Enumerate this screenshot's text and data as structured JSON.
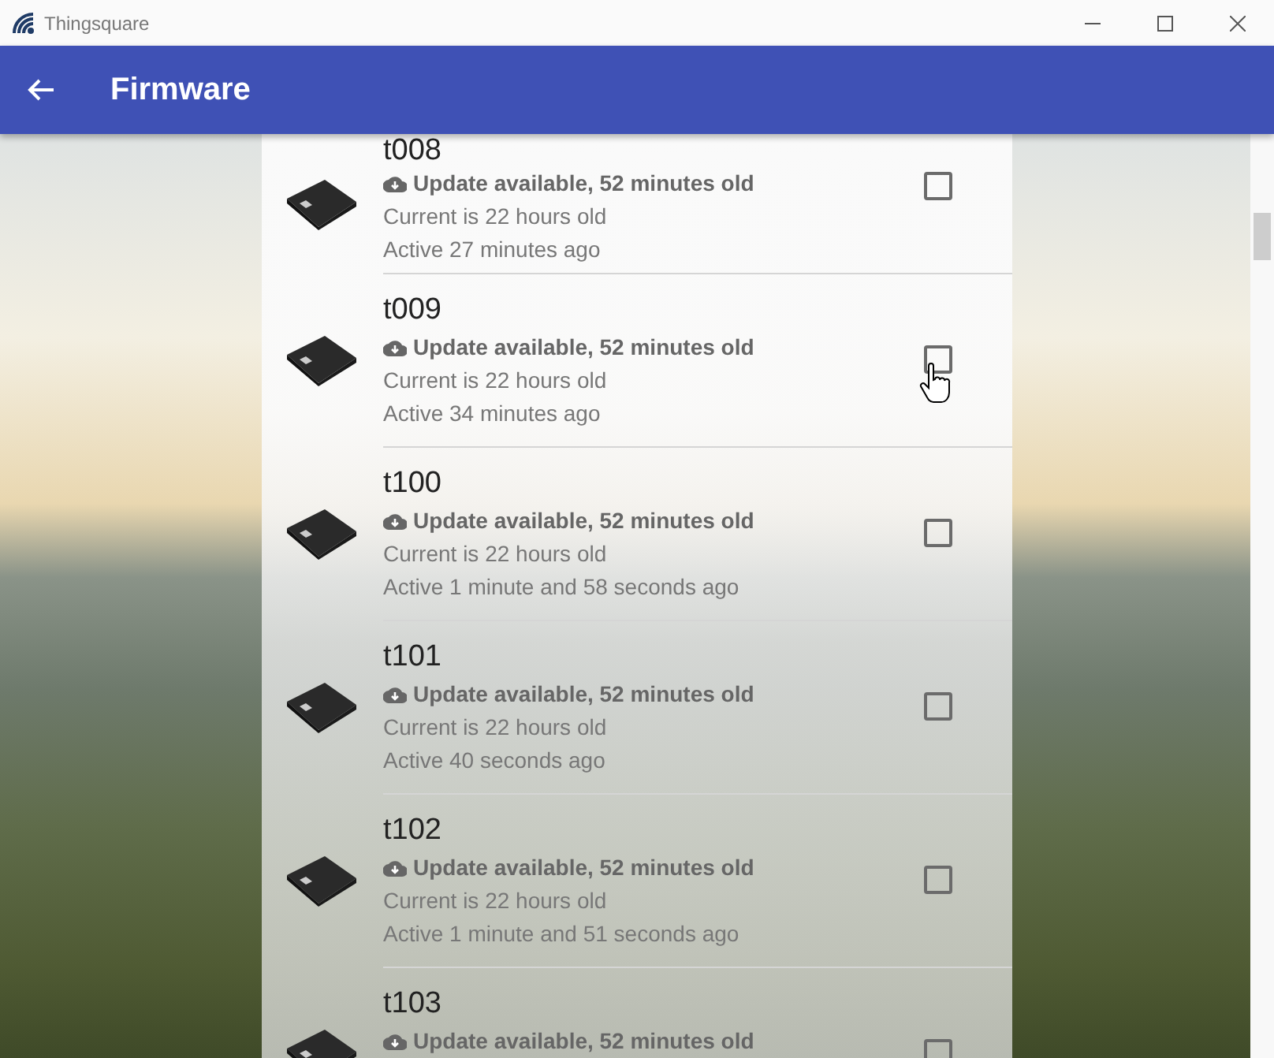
{
  "window": {
    "title": "Thingsquare"
  },
  "header": {
    "title": "Firmware"
  },
  "devices": [
    {
      "name": "t008",
      "update": "Update available, 52 minutes old",
      "current": "Current is 22 hours old",
      "active": "Active 27 minutes ago",
      "checked": false
    },
    {
      "name": "t009",
      "update": "Update available, 52 minutes old",
      "current": "Current is 22 hours old",
      "active": "Active 34 minutes ago",
      "checked": false
    },
    {
      "name": "t100",
      "update": "Update available, 52 minutes old",
      "current": "Current is 22 hours old",
      "active": "Active 1 minute and 58 seconds ago",
      "checked": false
    },
    {
      "name": "t101",
      "update": "Update available, 52 minutes old",
      "current": "Current is 22 hours old",
      "active": "Active 40 seconds ago",
      "checked": false
    },
    {
      "name": "t102",
      "update": "Update available, 52 minutes old",
      "current": "Current is 22 hours old",
      "active": "Active 1 minute and 51 seconds ago",
      "checked": false
    },
    {
      "name": "t103",
      "update": "Update available, 52 minutes old",
      "checked": false
    }
  ]
}
